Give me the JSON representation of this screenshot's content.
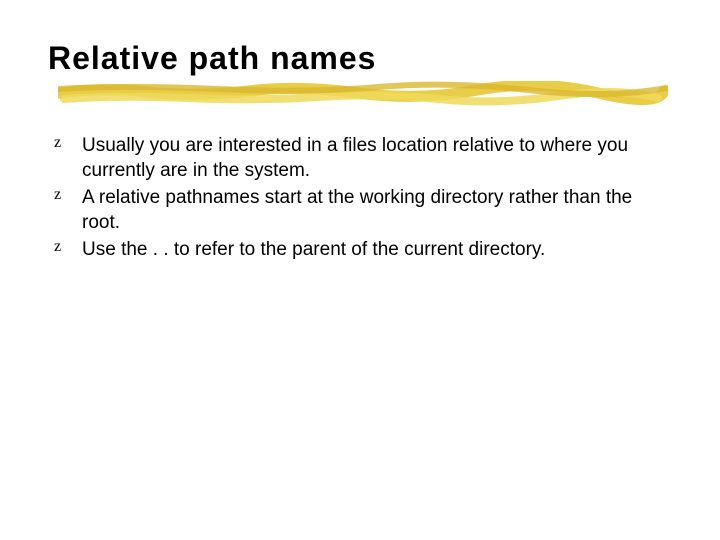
{
  "title": "Relative path names",
  "bullets": [
    "Usually you are interested in a files location relative to where you currently are in the system.",
    "A relative pathnames start at the working directory rather than the root.",
    "Use the . . to refer to the parent of the current directory."
  ],
  "bullet_marker": "z"
}
